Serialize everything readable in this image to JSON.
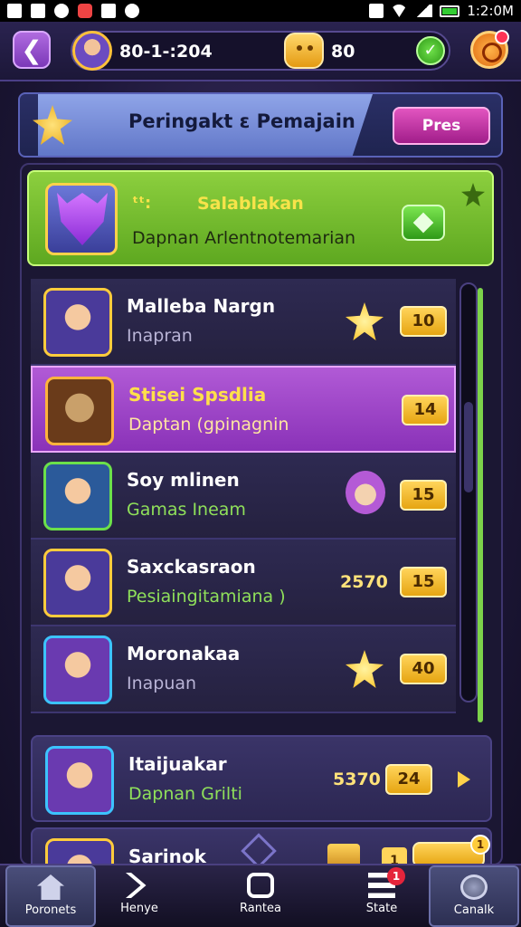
{
  "status_bar": {
    "time": "1:2:0M"
  },
  "top_bar": {
    "player_id": "80-1-:204",
    "coins": "80"
  },
  "banner": {
    "title": "Peringakt ɛ Pemajain",
    "button_label": "Pres"
  },
  "highlight": {
    "tag": "ᵗᵗ:",
    "name": "Salablakan",
    "subtitle": "Dapnan Arlentnotemarian"
  },
  "rows": [
    {
      "name": "Malleba Nargn",
      "sub": "Inapran",
      "score": "10",
      "points": ""
    },
    {
      "name": "Stisei Spsdlia",
      "sub": "Daptan (gpinagnin",
      "score": "14",
      "points": ""
    },
    {
      "name": "Soy mlinen",
      "sub": "Gamas Ineam",
      "score": "15",
      "points": ""
    },
    {
      "name": "Saxckasraon",
      "sub": "Pesiaingitamiana )",
      "score": "15",
      "points": "2570"
    },
    {
      "name": "Moronakaa",
      "sub": "Inapuan",
      "score": "40",
      "points": ""
    }
  ],
  "lower_rows": [
    {
      "name": "Itaijuakar",
      "sub": "Dapnan Grilti",
      "score": "24",
      "points": "5370"
    },
    {
      "name": "Sarinok",
      "small_badge": "1",
      "pill_badge": "1"
    }
  ],
  "bottom_nav": [
    {
      "label": "Poronets",
      "badge": ""
    },
    {
      "label": "Henye",
      "badge": ""
    },
    {
      "label": "Rantea",
      "badge": ""
    },
    {
      "label": "State",
      "badge": "1"
    },
    {
      "label": "Canalk",
      "badge": ""
    }
  ]
}
